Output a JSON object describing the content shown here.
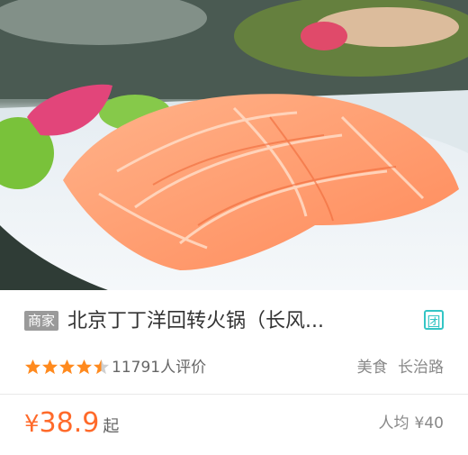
{
  "listing": {
    "merchant_tag": "商家",
    "title": "北京丁丁洋回转火锅（长风...",
    "deal_tag": "团",
    "rating": 4.5,
    "rating_max": 5,
    "reviews": "11791人评价",
    "category": "美食",
    "district": "长治路",
    "price_symbol": "¥",
    "price_value": "38.9",
    "price_suffix": "起",
    "avg_label": "人均",
    "avg_value": "¥40"
  },
  "colors": {
    "price": "#ff6a2a",
    "star": "#ff8a1e",
    "deal_tag": "#33c5c5",
    "merchant_tag_bg": "#9a9a9a"
  },
  "icons": {
    "hero": "salmon-hotpot-photo",
    "star": "star-icon"
  }
}
